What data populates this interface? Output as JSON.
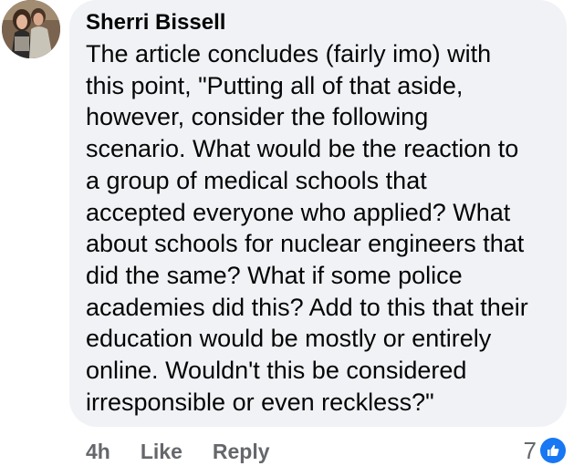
{
  "comment": {
    "author": "Sherri Bissell",
    "text_lines": [
      "The article concludes (fairly imo) with",
      "this point, \"Putting all of that aside,",
      "however, consider the following",
      "scenario. What would be the reaction to",
      "a group of medical schools that",
      "accepted everyone who applied? What",
      "about schools for nuclear engineers that",
      "did the same? What if some police",
      "academies did this? Add to this that their",
      "education would be mostly or entirely",
      "online. Wouldn't this be considered",
      "irresponsible or even reckless?\""
    ],
    "timestamp": "4h",
    "like_label": "Like",
    "reply_label": "Reply",
    "reaction_count": "7",
    "reaction_icon": "thumbs-up-icon",
    "bubble_color": "#f0f2f5",
    "reaction_color": "#1877f2"
  }
}
